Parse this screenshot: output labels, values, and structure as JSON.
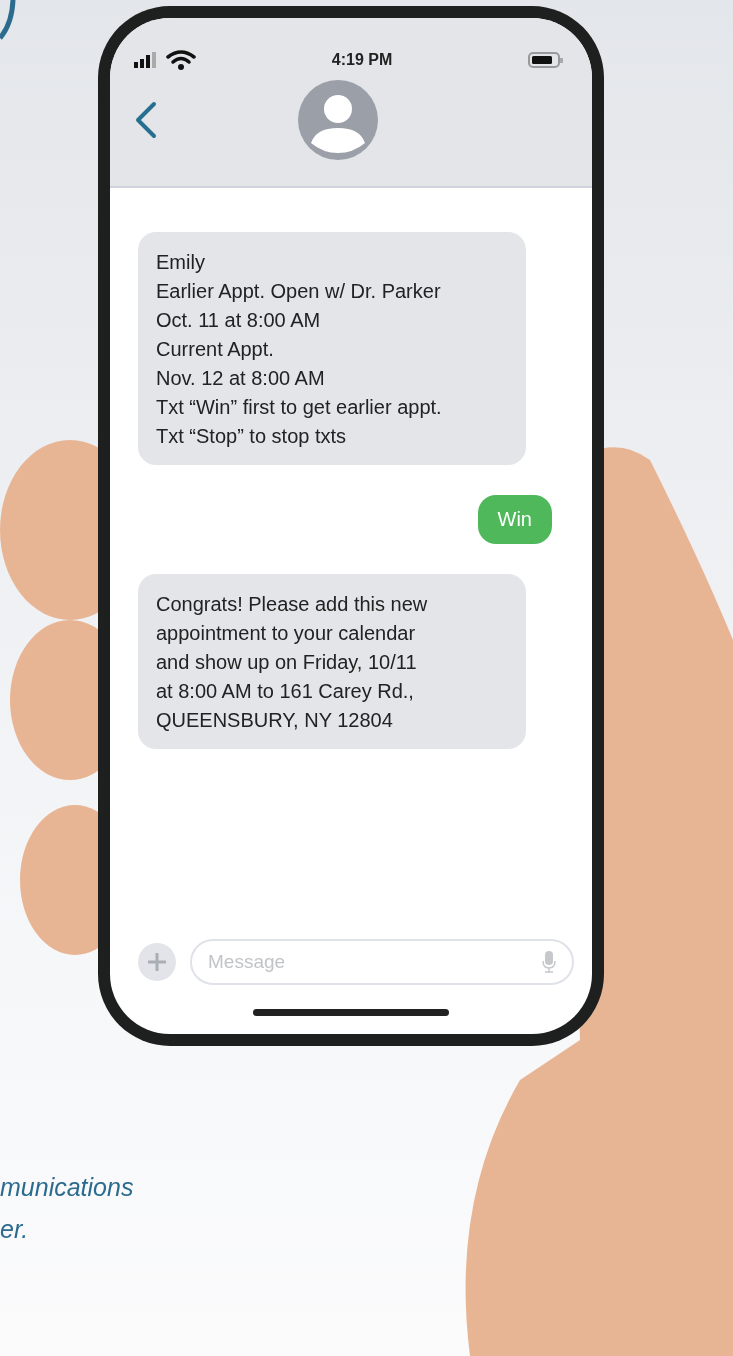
{
  "status_bar": {
    "time": "4:19 PM"
  },
  "messages": [
    {
      "kind": "incoming",
      "text": "Emily\nEarlier Appt. Open w/ Dr. Parker\nOct. 11 at 8:00 AM\nCurrent Appt.\nNov. 12 at 8:00 AM\nTxt “Win” first to get earlier appt.\nTxt “Stop” to stop txts"
    },
    {
      "kind": "outgoing",
      "text": "Win"
    },
    {
      "kind": "incoming",
      "text": "Congrats! Please add this new\nappointment to your calendar\nand show up on Friday, 10/11\nat 8:00 AM to 161 Carey Rd.,\nQUEENSBURY, NY 12804"
    }
  ],
  "composer": {
    "placeholder": "Message"
  },
  "caption": [
    "munications",
    "er."
  ]
}
